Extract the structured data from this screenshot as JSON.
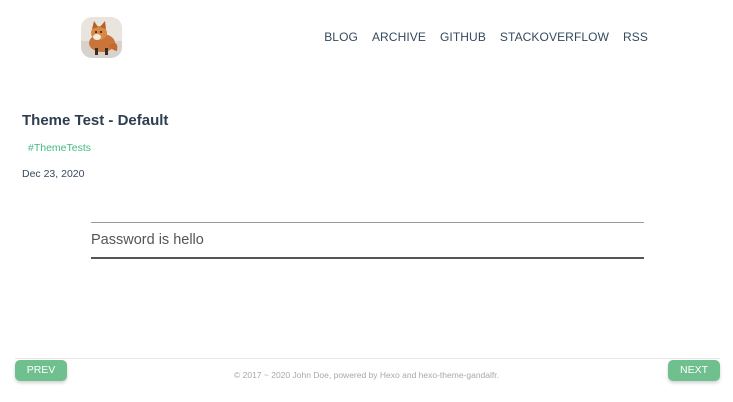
{
  "header": {
    "avatar_icon": "fox-avatar-icon",
    "nav": [
      {
        "label": "BLOG"
      },
      {
        "label": "ARCHIVE"
      },
      {
        "label": "GITHUB"
      },
      {
        "label": "STACKOVERFLOW"
      },
      {
        "label": "RSS"
      }
    ]
  },
  "post": {
    "title": "Theme Test - Default",
    "tag": "#ThemeTests",
    "date": "Dec 23, 2020",
    "password_placeholder": "Password is hello"
  },
  "footer": {
    "prev_label": "PREV",
    "next_label": "NEXT",
    "copyright": "© 2017 ~ 2020 John Doe, powered by Hexo and hexo-theme-gandalfr."
  },
  "colors": {
    "accent": "#42b983",
    "button": "#6fc08e",
    "text": "#34495e"
  }
}
